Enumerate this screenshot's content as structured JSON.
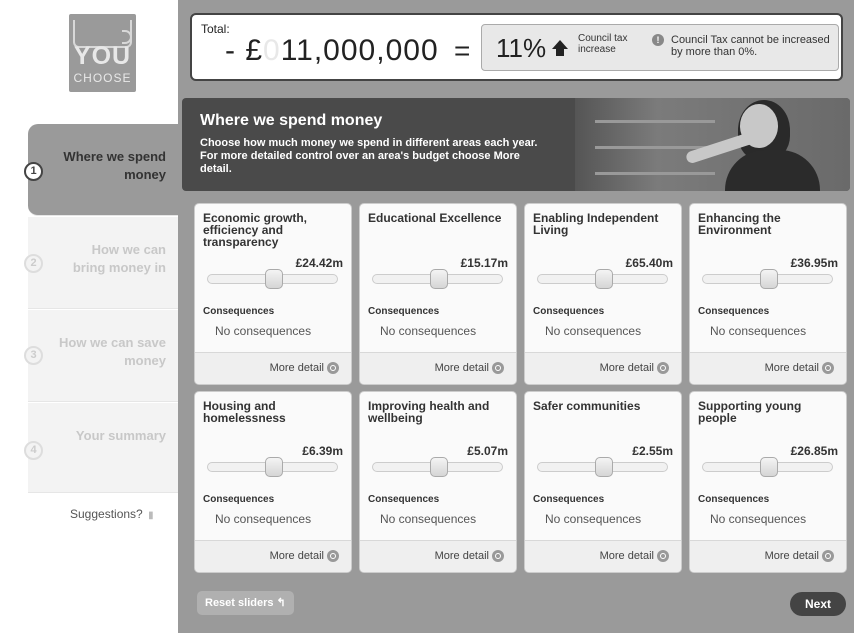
{
  "logo": {
    "you": "YOU",
    "choose": "CHOOSE"
  },
  "sidebar": {
    "steps": [
      {
        "number": "1",
        "label": "Where we spend money",
        "active": true
      },
      {
        "number": "2",
        "label": "How we can bring money in",
        "active": false
      },
      {
        "number": "3",
        "label": "How we can save money",
        "active": false
      },
      {
        "number": "4",
        "label": "Your summary",
        "active": false
      }
    ],
    "suggestions": "Suggestions?"
  },
  "total": {
    "label": "Total:",
    "prefix": "- £",
    "ghost_digit": "0",
    "amount": "11,000,000",
    "equals": "=",
    "tax_percent": "11%",
    "tax_caption": "Council tax increase",
    "tax_note": "Council Tax cannot be increased by more than 0%."
  },
  "banner": {
    "title": "Where we spend money",
    "text": "Choose how much money we spend in different areas each year. For more detailed control over an area's budget choose More detail."
  },
  "cards": [
    {
      "title": "Economic growth, efficiency and transparency",
      "value": "£24.42m",
      "slider_level": 0.5,
      "consequences_label": "Consequences",
      "consequences": "No consequences",
      "more": "More detail"
    },
    {
      "title": "Educational Excellence",
      "value": "£15.17m",
      "slider_level": 0.5,
      "consequences_label": "Consequences",
      "consequences": "No consequences",
      "more": "More detail"
    },
    {
      "title": "Enabling Independent Living",
      "value": "£65.40m",
      "slider_level": 0.5,
      "consequences_label": "Consequences",
      "consequences": "No consequences",
      "more": "More detail"
    },
    {
      "title": "Enhancing the Environment",
      "value": "£36.95m",
      "slider_level": 0.5,
      "consequences_label": "Consequences",
      "consequences": "No consequences",
      "more": "More detail"
    },
    {
      "title": "Housing and homelessness",
      "value": "£6.39m",
      "slider_level": 0.5,
      "consequences_label": "Consequences",
      "consequences": "No consequences",
      "more": "More detail"
    },
    {
      "title": "Improving health and wellbeing",
      "value": "£5.07m",
      "slider_level": 0.5,
      "consequences_label": "Consequences",
      "consequences": "No consequences",
      "more": "More detail"
    },
    {
      "title": "Safer communities",
      "value": "£2.55m",
      "slider_level": 0.5,
      "consequences_label": "Consequences",
      "consequences": "No consequences",
      "more": "More detail"
    },
    {
      "title": "Supporting young people",
      "value": "£26.85m",
      "slider_level": 0.5,
      "consequences_label": "Consequences",
      "consequences": "No consequences",
      "more": "More detail"
    }
  ],
  "footer": {
    "reset": "Reset sliders",
    "reset_glyph": "↰",
    "next": "Next"
  },
  "icons": {
    "suggestions": "speech-bubble-icon",
    "info": "info-icon",
    "more": "magnify-icon",
    "arrow": "up-arrow-icon"
  },
  "colors": {
    "panel": "#9a9a9a",
    "banner": "#4a4a4a",
    "next": "#444444"
  }
}
